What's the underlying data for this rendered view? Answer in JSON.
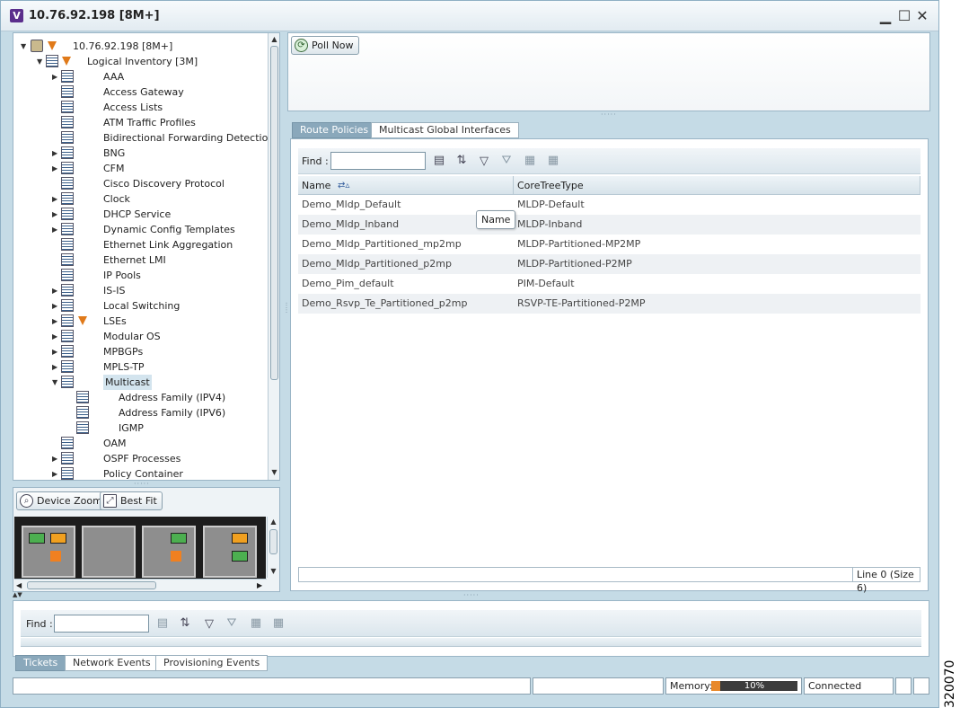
{
  "window": {
    "app_icon": "V",
    "title": "10.76.92.198 [8M+]",
    "minimize_glyph": "▁",
    "maximize_glyph": "☐",
    "close_glyph": "✕"
  },
  "tree": {
    "root": "10.76.92.198 [8M+]",
    "logical_inventory": "Logical Inventory [3M]",
    "items": [
      {
        "label": "AAA",
        "expandable": true
      },
      {
        "label": "Access Gateway",
        "expandable": false
      },
      {
        "label": "Access Lists",
        "expandable": false
      },
      {
        "label": "ATM Traffic Profiles",
        "expandable": false
      },
      {
        "label": "Bidirectional Forwarding Detection",
        "expandable": false
      },
      {
        "label": "BNG",
        "expandable": true
      },
      {
        "label": "CFM",
        "expandable": true
      },
      {
        "label": "Cisco Discovery Protocol",
        "expandable": false
      },
      {
        "label": "Clock",
        "expandable": true
      },
      {
        "label": "DHCP Service",
        "expandable": true
      },
      {
        "label": "Dynamic Config Templates",
        "expandable": true
      },
      {
        "label": "Ethernet Link Aggregation",
        "expandable": false
      },
      {
        "label": "Ethernet LMI",
        "expandable": false
      },
      {
        "label": "IP Pools",
        "expandable": false
      },
      {
        "label": "IS-IS",
        "expandable": true
      },
      {
        "label": "Local Switching",
        "expandable": true
      },
      {
        "label": "LSEs",
        "expandable": true
      },
      {
        "label": "Modular OS",
        "expandable": true
      },
      {
        "label": "MPBGPs",
        "expandable": true
      },
      {
        "label": "MPLS-TP",
        "expandable": true
      },
      {
        "label": "Multicast",
        "expandable": true,
        "expanded": true
      },
      {
        "label": "Address Family (IPV4)",
        "child": true
      },
      {
        "label": "Address Family (IPV6)",
        "child": true
      },
      {
        "label": "IGMP",
        "child": true
      },
      {
        "label": "OAM",
        "expandable": false
      },
      {
        "label": "OSPF Processes",
        "expandable": true
      },
      {
        "label": "Policy Container",
        "expandable": true
      }
    ]
  },
  "device_view": {
    "device_zoom_label": "Device Zoom",
    "best_fit_label": "Best Fit"
  },
  "top_toolbar": {
    "poll_now_label": "Poll Now"
  },
  "tabs": [
    {
      "label": "Route Policies",
      "active": true
    },
    {
      "label": "Multicast Global Interfaces",
      "active": false
    }
  ],
  "route_policies": {
    "find_label": "Find :",
    "find_value": "",
    "columns": [
      "Name",
      "CoreTreeType"
    ],
    "rows": [
      [
        "Demo_Mldp_Default",
        "MLDP-Default"
      ],
      [
        "Demo_Mldp_Inband",
        "MLDP-Inband"
      ],
      [
        "Demo_Mldp_Partitioned_mp2mp",
        "MLDP-Partitioned-MP2MP"
      ],
      [
        "Demo_Mldp_Partitioned_p2mp",
        "MLDP-Partitioned-P2MP"
      ],
      [
        "Demo_Pim_default",
        "PIM-Default"
      ],
      [
        "Demo_Rsvp_Te_Partitioned_p2mp",
        "RSVP-TE-Partitioned-P2MP"
      ]
    ],
    "tooltip": "Name",
    "status": "Line 0 (Size 6)"
  },
  "bottom_panel": {
    "find_label": "Find :",
    "find_value": "",
    "tabs": [
      {
        "label": "Tickets",
        "active": true
      },
      {
        "label": "Network Events",
        "active": false
      },
      {
        "label": "Provisioning Events",
        "active": false
      }
    ]
  },
  "statusbar": {
    "memory_label": "Memory:",
    "memory_percent": 10,
    "memory_text": "10%",
    "connection": "Connected"
  },
  "figure_number": "320070",
  "colors": {
    "accent": "#8aa8bb",
    "window_bg": "#c5dbe6",
    "memory_fill": "#e8892b",
    "warning": "#e07a1a"
  }
}
